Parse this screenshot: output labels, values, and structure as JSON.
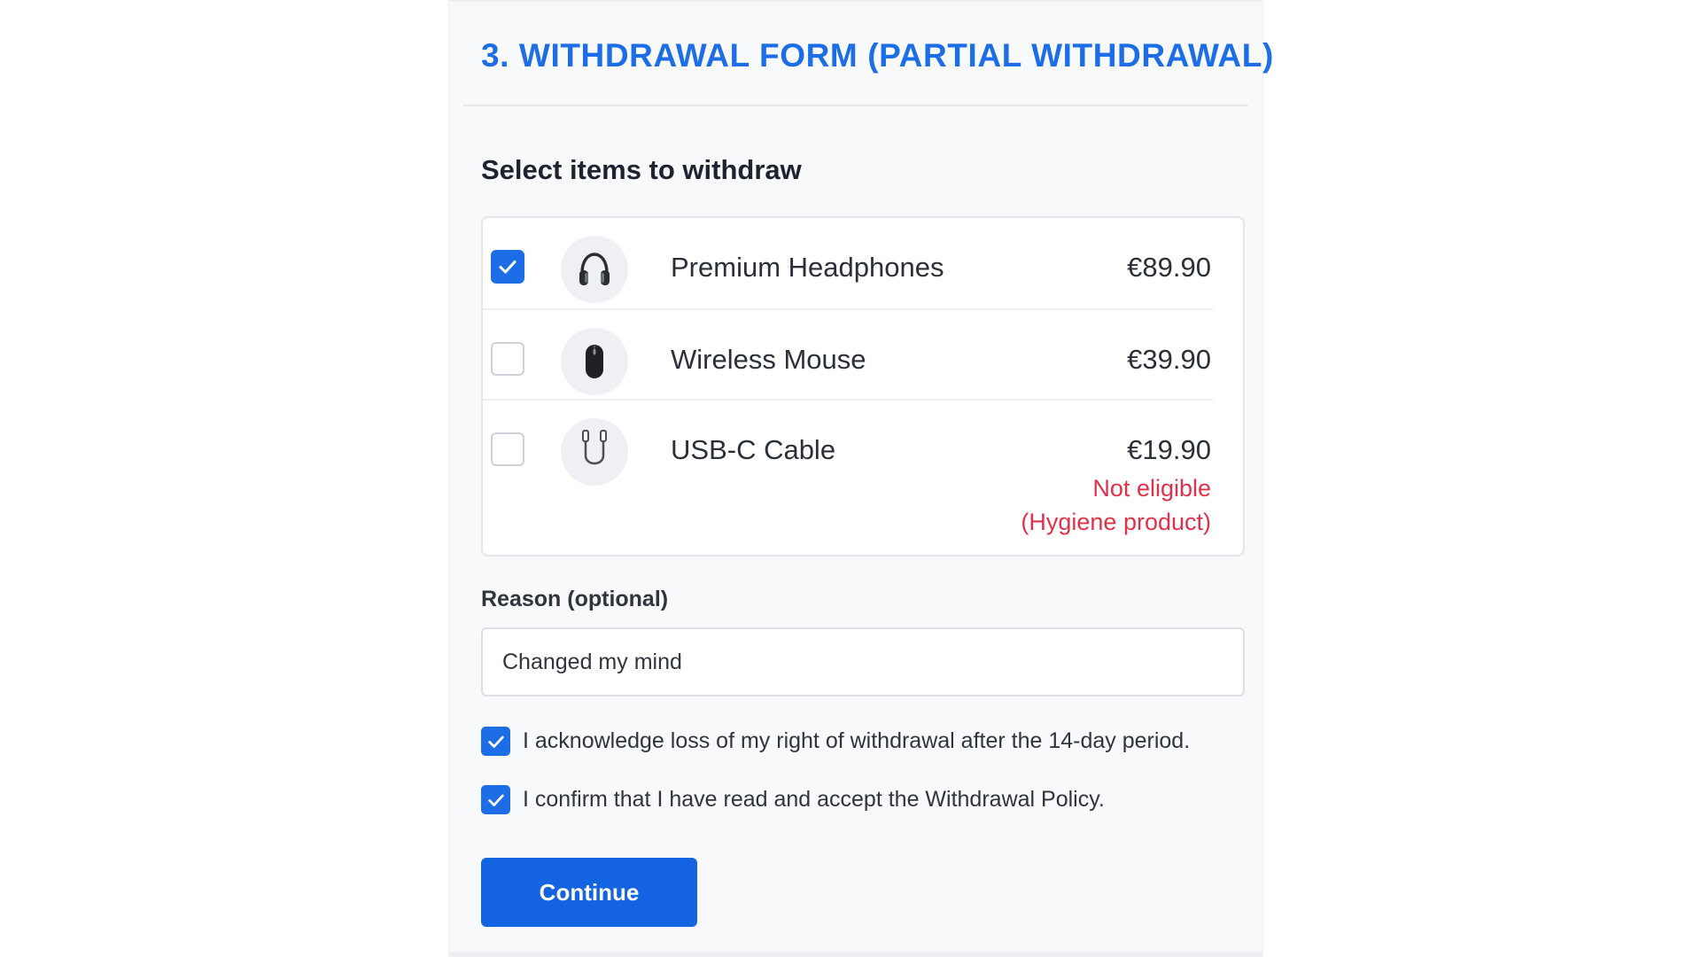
{
  "form": {
    "title": "3. WITHDRAWAL FORM (PARTIAL WITHDRAWAL)",
    "section_title": "Select items to withdraw"
  },
  "items": [
    {
      "name": "Premium Headphones",
      "price": "€89.90",
      "checked": true,
      "icon": "headphones-icon"
    },
    {
      "name": "Wireless Mouse",
      "price": "€39.90",
      "checked": false,
      "icon": "mouse-icon"
    },
    {
      "name": "USB-C Cable",
      "price": "€19.90",
      "checked": false,
      "icon": "cable-icon",
      "status_line1": "Not eligible",
      "status_line2": "(Hygiene product)"
    }
  ],
  "reason": {
    "label": "Reason (optional)",
    "value": "Changed my mind"
  },
  "acknowledgements": [
    {
      "text": "I acknowledge loss of my right of withdrawal after the 14-day period.",
      "checked": true
    },
    {
      "text": "I confirm that I have read and accept the Withdrawal Policy.",
      "checked": true
    }
  ],
  "continue_label": "Continue",
  "colors": {
    "accent": "#1d6ee6",
    "button": "#1463e0",
    "error": "#e0314b"
  }
}
